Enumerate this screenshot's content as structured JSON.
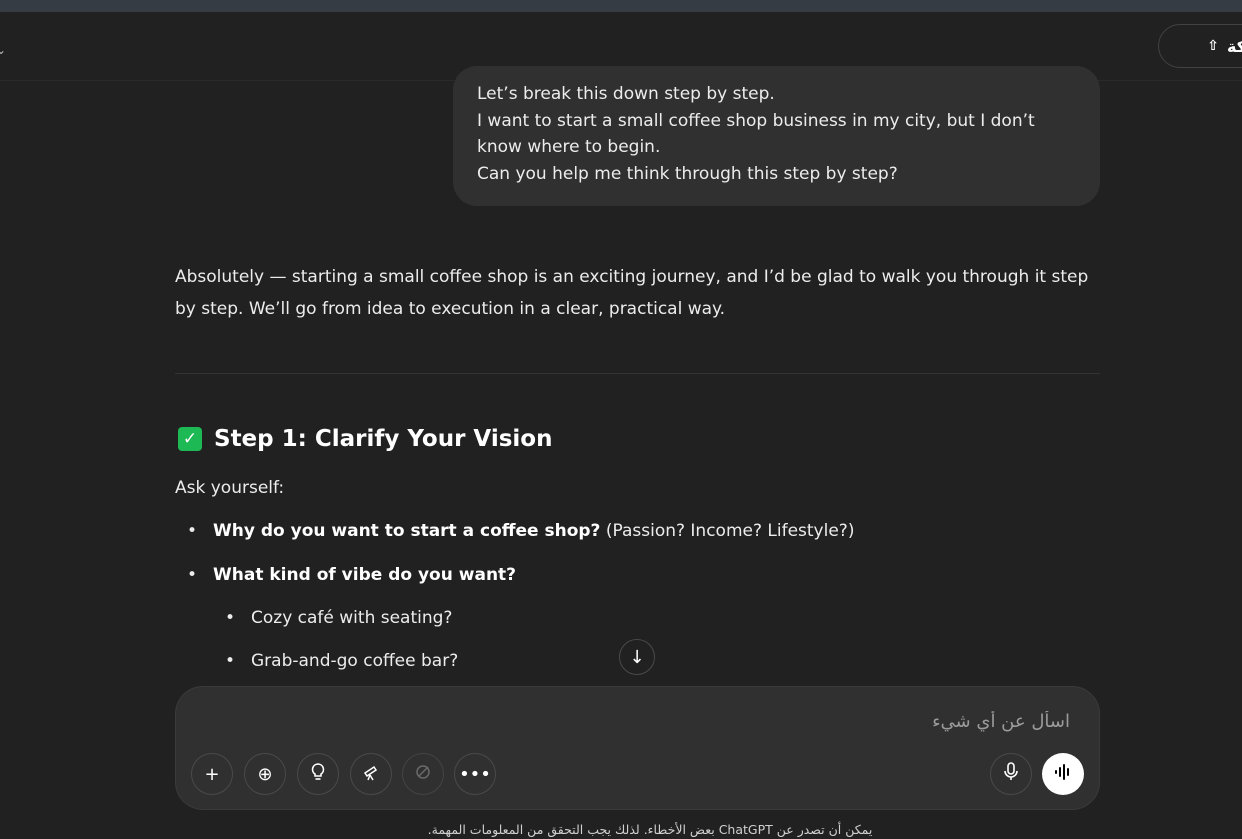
{
  "header": {
    "share_label": "شاركة"
  },
  "user_message": {
    "lines": [
      "Let’s break this down step by step.",
      "I want to start a small coffee shop business in my city, but I don’t",
      "know where to begin.",
      "Can you help me think through this step by step?"
    ]
  },
  "assistant": {
    "intro": "Absolutely — starting a small coffee shop is an exciting journey, and I’d be glad to walk you through it step by step. We’ll go from idea to execution in a clear, practical way.",
    "step1_title": "Step 1: Clarify Your Vision",
    "ask": "Ask yourself:",
    "bullets": [
      {
        "bold": "Why do you want to start a coffee shop?",
        "rest": " (Passion? Income? Lifestyle?)"
      },
      {
        "bold": "What kind of vibe do you want?",
        "rest": ""
      }
    ],
    "sub_bullets": [
      "Cozy café with seating?",
      "Grab-and-go coffee bar?"
    ]
  },
  "composer": {
    "placeholder": "اسأل عن أي شيء"
  },
  "footer": {
    "note": "يمكن أن تصدر عن ChatGPT بعض الأخطاء. لذلك يجب التحقق من المعلومات المهمة."
  },
  "icons": {
    "share": "share-icon",
    "scroll_down": "arrow-down-icon",
    "tools": [
      "plus-icon",
      "globe-icon",
      "lightbulb-icon",
      "telescope-icon",
      "paint-icon",
      "more-icon"
    ],
    "mic": "microphone-icon",
    "voice": "voice-mode-icon"
  },
  "colors": {
    "background": "#212121",
    "bubble": "#303030",
    "check_green": "#1db954"
  }
}
